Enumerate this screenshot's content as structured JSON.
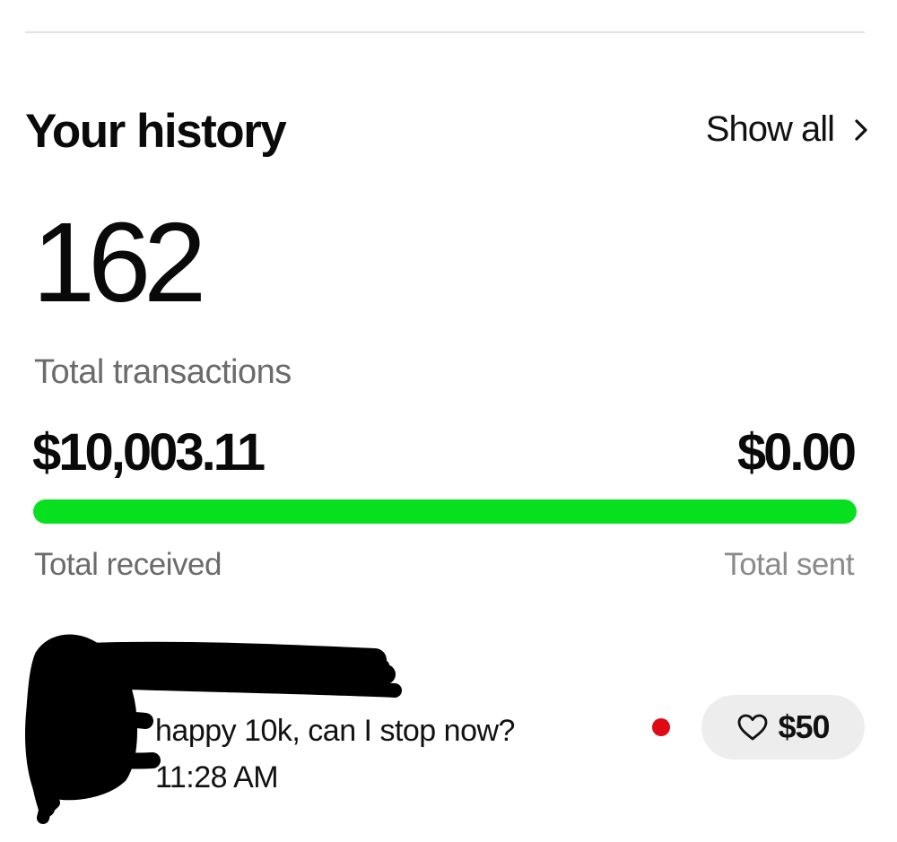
{
  "history": {
    "title": "Your history",
    "show_all_label": "Show all",
    "show_all_icon": "chevron-right-icon"
  },
  "summary": {
    "transaction_count": "162",
    "transaction_count_label": "Total transactions",
    "total_received": "$10,003.11",
    "total_sent": "$0.00",
    "total_received_label": "Total received",
    "total_sent_label": "Total sent",
    "received_share": 1.0,
    "bar_color": "#06e01e"
  },
  "transaction": {
    "message": "happy 10k, can I stop now?",
    "time": "11:28 AM",
    "unread_color": "#df0a14",
    "like_icon": "heart-outline-icon",
    "like_amount": "$50"
  }
}
